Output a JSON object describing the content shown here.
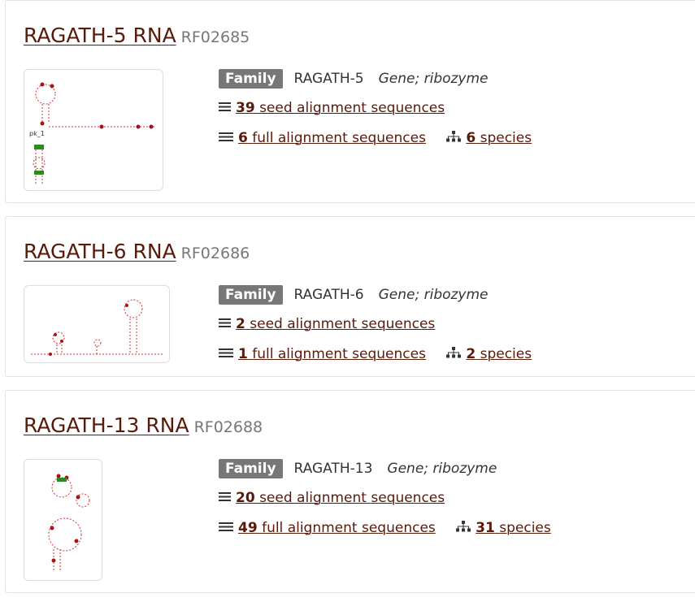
{
  "results": [
    {
      "title": "RAGATH-5 RNA",
      "accession": "RF02685",
      "badge": "Family",
      "family_name": "RAGATH-5",
      "family_type": "Gene; ribozyme",
      "seed_count": "39",
      "seed_label": "seed alignment sequences",
      "full_count": "6",
      "full_label": "full alignment sequences",
      "species_count": "6",
      "species_label": "species",
      "thumb_label": "pk_1"
    },
    {
      "title": "RAGATH-6 RNA",
      "accession": "RF02686",
      "badge": "Family",
      "family_name": "RAGATH-6",
      "family_type": "Gene; ribozyme",
      "seed_count": "2",
      "seed_label": "seed alignment sequences",
      "full_count": "1",
      "full_label": "full alignment sequences",
      "species_count": "2",
      "species_label": "species"
    },
    {
      "title": "RAGATH-13 RNA",
      "accession": "RF02688",
      "badge": "Family",
      "family_name": "RAGATH-13",
      "family_type": "Gene; ribozyme",
      "seed_count": "20",
      "seed_label": "seed alignment sequences",
      "full_count": "49",
      "full_label": "full alignment sequences",
      "species_count": "31",
      "species_label": "species"
    }
  ],
  "icons": {
    "list": "list-icon",
    "species": "sitemap-icon"
  },
  "colors": {
    "link": "#5a1a0a",
    "badge": "#777777",
    "accession": "#777777"
  }
}
